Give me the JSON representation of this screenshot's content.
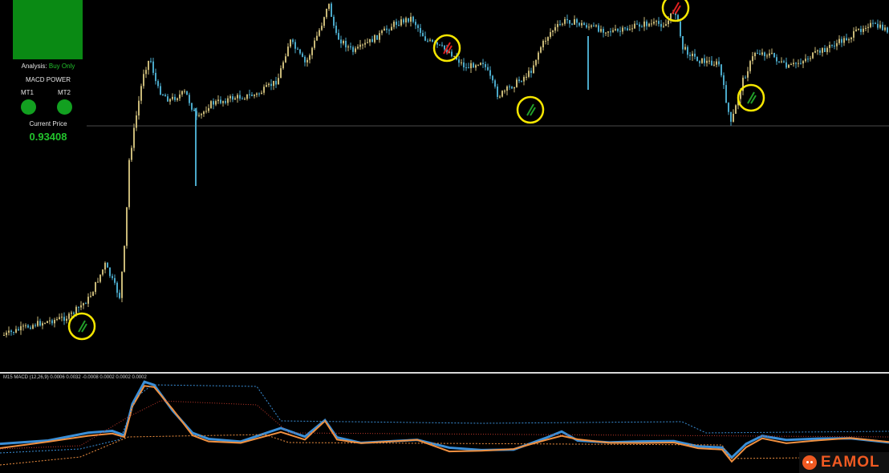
{
  "panel": {
    "analysis_label": "Analysis:",
    "analysis_value": "Buy Only",
    "macd_power_label": "MACD POWER",
    "mt1_label": "MT1",
    "mt2_label": "MT2",
    "current_price_label": "Current Price",
    "current_price": "0.93408"
  },
  "macd": {
    "header": "M15 MACD (12,26,9) 0.0006 0.0032 -0.0008 0.0002 0.0002 0.0002"
  },
  "brand": {
    "name": "EAMOL"
  },
  "colors": {
    "bull": "#c8b877",
    "bear": "#4aa8c8",
    "macd_line": "#3a8fd8",
    "signal_line": "#f09040",
    "buy_marker": "#22a02a",
    "sell_marker": "#e02020",
    "highlight_ring": "#f5e600"
  }
}
